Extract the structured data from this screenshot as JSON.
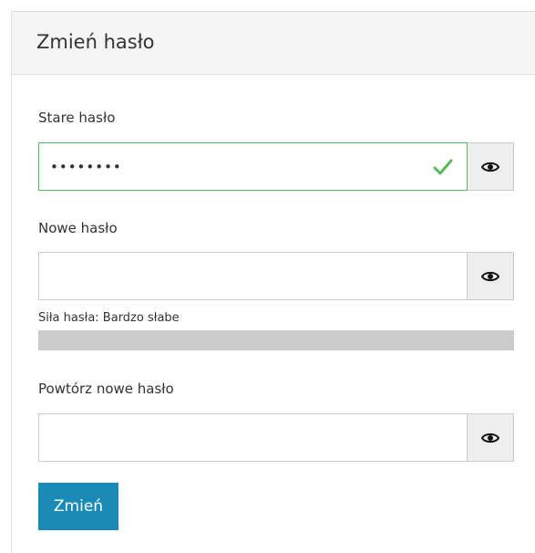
{
  "panel": {
    "title": "Zmień hasło"
  },
  "fields": {
    "old_password": {
      "label": "Stare hasło",
      "value": "••••••••",
      "state": "valid"
    },
    "new_password": {
      "label": "Nowe hasło",
      "value": ""
    },
    "repeat_password": {
      "label": "Powtórz nowe hasło",
      "value": ""
    }
  },
  "strength": {
    "label": "Siła hasła: Bardzo słabe",
    "level": 0
  },
  "submit": {
    "label": "Zmień"
  },
  "icons": {
    "toggle": "eye-icon",
    "valid": "check-icon"
  },
  "colors": {
    "valid": "#5cb85c",
    "primary": "#1a8bb7",
    "strength_track": "#cccccc"
  }
}
